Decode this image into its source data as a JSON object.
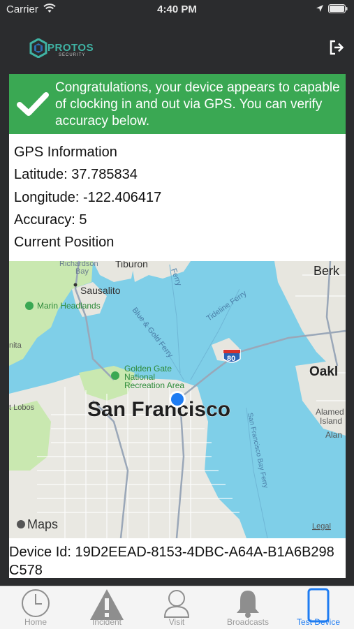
{
  "status_bar": {
    "carrier": "Carrier",
    "time": "4:40 PM"
  },
  "header": {
    "logo_brand": "PROTOS",
    "logo_sub": "SECURITY"
  },
  "banner": {
    "message": "Congratulations, your device appears to capable of clocking in and out via GPS. You can verify accuracy below."
  },
  "gps": {
    "heading": "GPS Information",
    "latitude": "Latitude: 37.785834",
    "longitude": "Longitude: -122.406417",
    "accuracy": "Accuracy: 5",
    "current_position": "Current Position"
  },
  "map": {
    "city": "San Francisco",
    "labels": {
      "richardson": "Richardson",
      "bay": "Bay",
      "tiburon": "Tiburon",
      "sausalito": "Sausalito",
      "marin": "Marin Headlands",
      "ferry_top": "Ferry",
      "blue_gold": "Blue & Gold Ferry",
      "tideline": "Tideline Ferry",
      "golden_gate_1": "Golden Gate",
      "golden_gate_2": "National",
      "golden_gate_3": "Recreation Area",
      "lobos": "t Lobos",
      "berk": "Berk",
      "oakl": "Oakl",
      "alameda": "Alamed",
      "island": "Island",
      "alan": "Alan",
      "sf_bay_ferry": "San Francisco Bay Ferry",
      "nita": "nita",
      "highway": "80",
      "maps": "Maps",
      "legal": "Legal"
    }
  },
  "device": {
    "id_text": "Device Id: 19D2EEAD-8153-4DBC-A64A-B1A6B298C578"
  },
  "tabs": [
    {
      "label": "Home",
      "icon": "clock-icon"
    },
    {
      "label": "Incident",
      "icon": "warning-icon"
    },
    {
      "label": "Visit",
      "icon": "person-icon"
    },
    {
      "label": "Broadcasts",
      "icon": "bell-icon"
    },
    {
      "label": "Test Device",
      "icon": "phone-icon",
      "active": true
    }
  ],
  "colors": {
    "accent": "#1e7cf2",
    "banner_green": "#3aa853",
    "header_bg": "#2b2c2e",
    "brand_teal": "#3fb3a4"
  }
}
